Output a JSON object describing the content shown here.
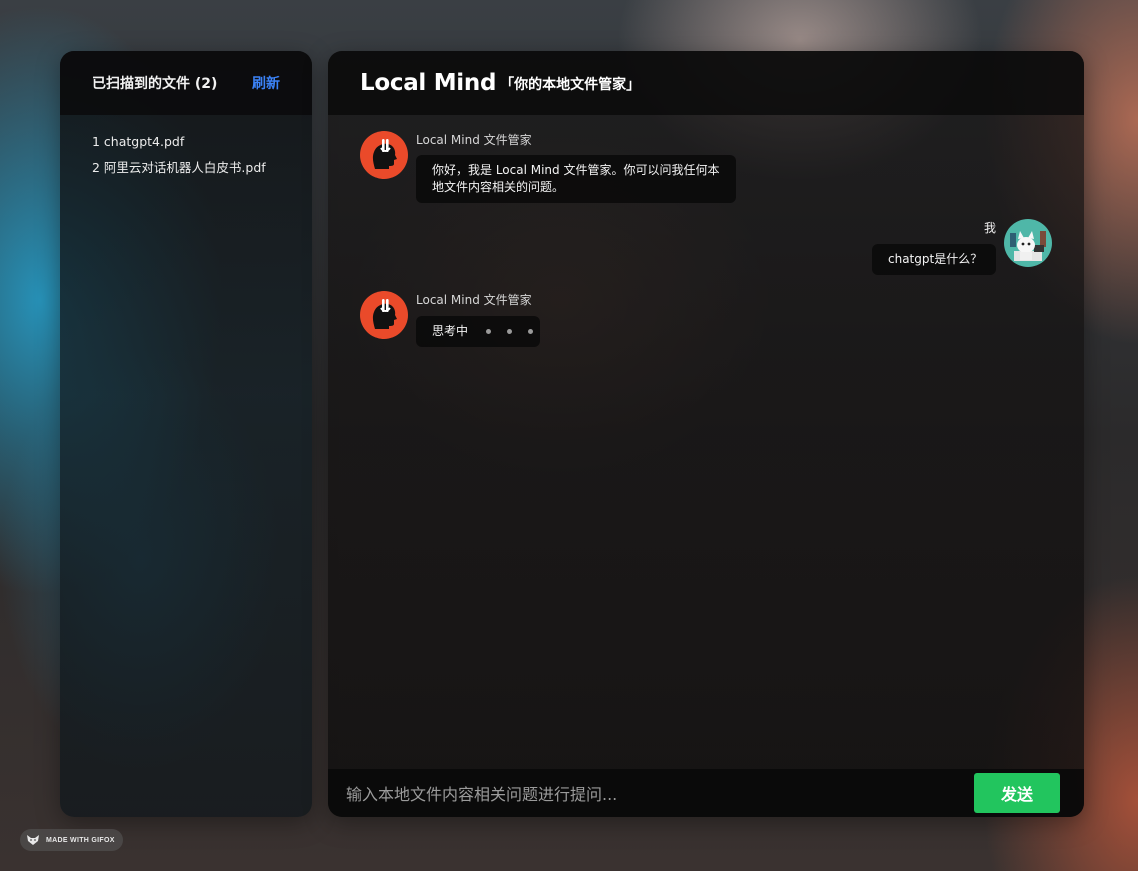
{
  "sidebar": {
    "title": "已扫描到的文件 (2)",
    "refresh_label": "刷新",
    "files": [
      "1 chatgpt4.pdf",
      "2 阿里云对话机器人白皮书.pdf"
    ]
  },
  "header": {
    "title": "Local Mind",
    "subtitle": "「你的本地文件管家」"
  },
  "messages": [
    {
      "role": "assistant",
      "sender": "Local Mind 文件管家",
      "text_line1": "你好，我是 Local Mind 文件管家。你可以问我任何本",
      "text_line2": "地文件内容相关的问题。"
    },
    {
      "role": "user",
      "sender": "我",
      "text": "chatgpt是什么？"
    },
    {
      "role": "assistant",
      "sender": "Local Mind 文件管家",
      "text": "思考中"
    }
  ],
  "input": {
    "placeholder": "输入本地文件内容相关问题进行提问...",
    "value": ""
  },
  "send_label": "发送",
  "watermark": "MADE WITH GIFOX",
  "colors": {
    "accent_blue": "#3b82f6",
    "send_green": "#22c55e",
    "bot_avatar": "#ea4a2a",
    "user_avatar": "#4fb7a8"
  },
  "icons": {
    "bot_avatar": "head-silhouette-icon",
    "user_avatar": "cat-avatar-icon",
    "watermark": "fox-icon",
    "typing": "typing-dots-icon"
  }
}
